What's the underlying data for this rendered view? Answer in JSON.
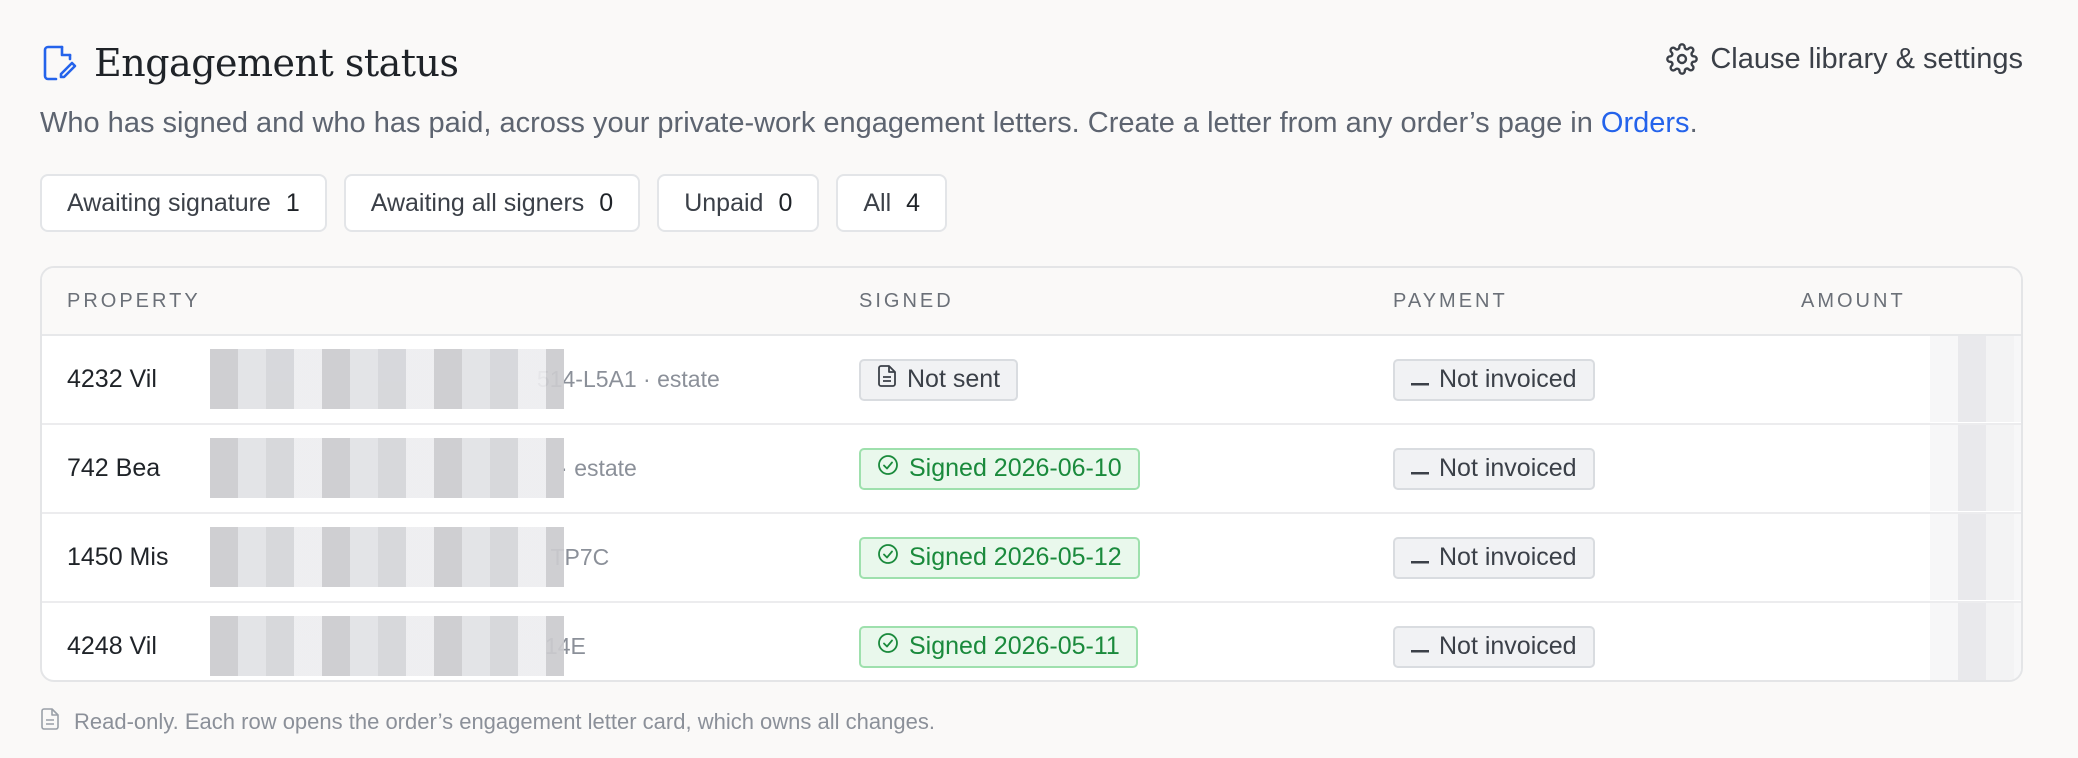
{
  "header": {
    "title": "Engagement status",
    "settings_label": "Clause library & settings"
  },
  "subtitle": {
    "text_before": "Who has signed and who has paid, across your private-work engagement letters. Create a letter from any order’s page in ",
    "link": "Orders",
    "text_after": "."
  },
  "filters": [
    {
      "label": "Awaiting signature",
      "count": "1"
    },
    {
      "label": "Awaiting all signers",
      "count": "0"
    },
    {
      "label": "Unpaid",
      "count": "0"
    },
    {
      "label": "All",
      "count": "4"
    }
  ],
  "table": {
    "columns": [
      "PROPERTY",
      "SIGNED",
      "PAYMENT",
      "AMOUNT"
    ],
    "rows": [
      {
        "property": "4232 Vil",
        "meta": "514-L5A1 · estate",
        "signed": "Not sent",
        "payment": "Not invoiced"
      },
      {
        "property": "742 Bea",
        "meta": "· estate",
        "signed": "Signed 2026-06-10",
        "payment": "Not invoiced"
      },
      {
        "property": "1450 Mis",
        "meta": "TP7C",
        "signed": "Signed 2026-05-12",
        "payment": "Not invoiced"
      },
      {
        "property": "4248 Vil",
        "meta": "14E",
        "signed": "Signed 2026-05-11",
        "payment": "Not invoiced"
      }
    ]
  },
  "footer": {
    "text": "Read-only. Each row opens the order’s engagement letter card, which owns all changes."
  },
  "colors": {
    "accent": "#2463eb",
    "signed_green": "#1a8a3c",
    "signed_bg": "#e9f8ec"
  },
  "icons": {
    "title": "edit-document-icon",
    "settings": "gear-icon",
    "not_sent": "document-icon",
    "signed": "check-circle-icon",
    "not_invoiced": "dash-icon",
    "footer": "document-icon"
  }
}
